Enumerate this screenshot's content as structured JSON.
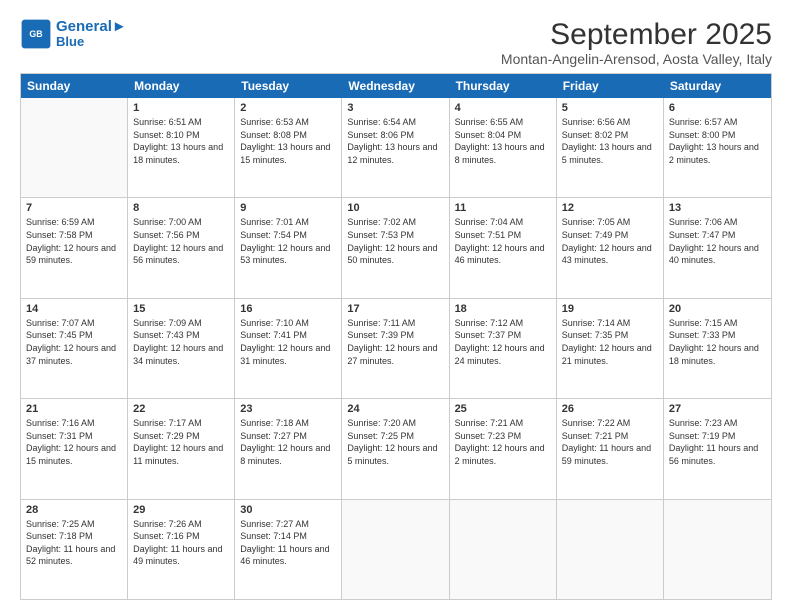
{
  "logo": {
    "line1": "General",
    "line2": "Blue"
  },
  "title": "September 2025",
  "subtitle": "Montan-Angelin-Arensod, Aosta Valley, Italy",
  "weekdays": [
    "Sunday",
    "Monday",
    "Tuesday",
    "Wednesday",
    "Thursday",
    "Friday",
    "Saturday"
  ],
  "weeks": [
    [
      {
        "day": "",
        "sunrise": "",
        "sunset": "",
        "daylight": ""
      },
      {
        "day": "1",
        "sunrise": "Sunrise: 6:51 AM",
        "sunset": "Sunset: 8:10 PM",
        "daylight": "Daylight: 13 hours and 18 minutes."
      },
      {
        "day": "2",
        "sunrise": "Sunrise: 6:53 AM",
        "sunset": "Sunset: 8:08 PM",
        "daylight": "Daylight: 13 hours and 15 minutes."
      },
      {
        "day": "3",
        "sunrise": "Sunrise: 6:54 AM",
        "sunset": "Sunset: 8:06 PM",
        "daylight": "Daylight: 13 hours and 12 minutes."
      },
      {
        "day": "4",
        "sunrise": "Sunrise: 6:55 AM",
        "sunset": "Sunset: 8:04 PM",
        "daylight": "Daylight: 13 hours and 8 minutes."
      },
      {
        "day": "5",
        "sunrise": "Sunrise: 6:56 AM",
        "sunset": "Sunset: 8:02 PM",
        "daylight": "Daylight: 13 hours and 5 minutes."
      },
      {
        "day": "6",
        "sunrise": "Sunrise: 6:57 AM",
        "sunset": "Sunset: 8:00 PM",
        "daylight": "Daylight: 13 hours and 2 minutes."
      }
    ],
    [
      {
        "day": "7",
        "sunrise": "Sunrise: 6:59 AM",
        "sunset": "Sunset: 7:58 PM",
        "daylight": "Daylight: 12 hours and 59 minutes."
      },
      {
        "day": "8",
        "sunrise": "Sunrise: 7:00 AM",
        "sunset": "Sunset: 7:56 PM",
        "daylight": "Daylight: 12 hours and 56 minutes."
      },
      {
        "day": "9",
        "sunrise": "Sunrise: 7:01 AM",
        "sunset": "Sunset: 7:54 PM",
        "daylight": "Daylight: 12 hours and 53 minutes."
      },
      {
        "day": "10",
        "sunrise": "Sunrise: 7:02 AM",
        "sunset": "Sunset: 7:53 PM",
        "daylight": "Daylight: 12 hours and 50 minutes."
      },
      {
        "day": "11",
        "sunrise": "Sunrise: 7:04 AM",
        "sunset": "Sunset: 7:51 PM",
        "daylight": "Daylight: 12 hours and 46 minutes."
      },
      {
        "day": "12",
        "sunrise": "Sunrise: 7:05 AM",
        "sunset": "Sunset: 7:49 PM",
        "daylight": "Daylight: 12 hours and 43 minutes."
      },
      {
        "day": "13",
        "sunrise": "Sunrise: 7:06 AM",
        "sunset": "Sunset: 7:47 PM",
        "daylight": "Daylight: 12 hours and 40 minutes."
      }
    ],
    [
      {
        "day": "14",
        "sunrise": "Sunrise: 7:07 AM",
        "sunset": "Sunset: 7:45 PM",
        "daylight": "Daylight: 12 hours and 37 minutes."
      },
      {
        "day": "15",
        "sunrise": "Sunrise: 7:09 AM",
        "sunset": "Sunset: 7:43 PM",
        "daylight": "Daylight: 12 hours and 34 minutes."
      },
      {
        "day": "16",
        "sunrise": "Sunrise: 7:10 AM",
        "sunset": "Sunset: 7:41 PM",
        "daylight": "Daylight: 12 hours and 31 minutes."
      },
      {
        "day": "17",
        "sunrise": "Sunrise: 7:11 AM",
        "sunset": "Sunset: 7:39 PM",
        "daylight": "Daylight: 12 hours and 27 minutes."
      },
      {
        "day": "18",
        "sunrise": "Sunrise: 7:12 AM",
        "sunset": "Sunset: 7:37 PM",
        "daylight": "Daylight: 12 hours and 24 minutes."
      },
      {
        "day": "19",
        "sunrise": "Sunrise: 7:14 AM",
        "sunset": "Sunset: 7:35 PM",
        "daylight": "Daylight: 12 hours and 21 minutes."
      },
      {
        "day": "20",
        "sunrise": "Sunrise: 7:15 AM",
        "sunset": "Sunset: 7:33 PM",
        "daylight": "Daylight: 12 hours and 18 minutes."
      }
    ],
    [
      {
        "day": "21",
        "sunrise": "Sunrise: 7:16 AM",
        "sunset": "Sunset: 7:31 PM",
        "daylight": "Daylight: 12 hours and 15 minutes."
      },
      {
        "day": "22",
        "sunrise": "Sunrise: 7:17 AM",
        "sunset": "Sunset: 7:29 PM",
        "daylight": "Daylight: 12 hours and 11 minutes."
      },
      {
        "day": "23",
        "sunrise": "Sunrise: 7:18 AM",
        "sunset": "Sunset: 7:27 PM",
        "daylight": "Daylight: 12 hours and 8 minutes."
      },
      {
        "day": "24",
        "sunrise": "Sunrise: 7:20 AM",
        "sunset": "Sunset: 7:25 PM",
        "daylight": "Daylight: 12 hours and 5 minutes."
      },
      {
        "day": "25",
        "sunrise": "Sunrise: 7:21 AM",
        "sunset": "Sunset: 7:23 PM",
        "daylight": "Daylight: 12 hours and 2 minutes."
      },
      {
        "day": "26",
        "sunrise": "Sunrise: 7:22 AM",
        "sunset": "Sunset: 7:21 PM",
        "daylight": "Daylight: 11 hours and 59 minutes."
      },
      {
        "day": "27",
        "sunrise": "Sunrise: 7:23 AM",
        "sunset": "Sunset: 7:19 PM",
        "daylight": "Daylight: 11 hours and 56 minutes."
      }
    ],
    [
      {
        "day": "28",
        "sunrise": "Sunrise: 7:25 AM",
        "sunset": "Sunset: 7:18 PM",
        "daylight": "Daylight: 11 hours and 52 minutes."
      },
      {
        "day": "29",
        "sunrise": "Sunrise: 7:26 AM",
        "sunset": "Sunset: 7:16 PM",
        "daylight": "Daylight: 11 hours and 49 minutes."
      },
      {
        "day": "30",
        "sunrise": "Sunrise: 7:27 AM",
        "sunset": "Sunset: 7:14 PM",
        "daylight": "Daylight: 11 hours and 46 minutes."
      },
      {
        "day": "",
        "sunrise": "",
        "sunset": "",
        "daylight": ""
      },
      {
        "day": "",
        "sunrise": "",
        "sunset": "",
        "daylight": ""
      },
      {
        "day": "",
        "sunrise": "",
        "sunset": "",
        "daylight": ""
      },
      {
        "day": "",
        "sunrise": "",
        "sunset": "",
        "daylight": ""
      }
    ]
  ],
  "colors": {
    "header_bg": "#1a6bb5",
    "header_text": "#ffffff",
    "border": "#cccccc",
    "empty_bg": "#f9f9f9"
  }
}
